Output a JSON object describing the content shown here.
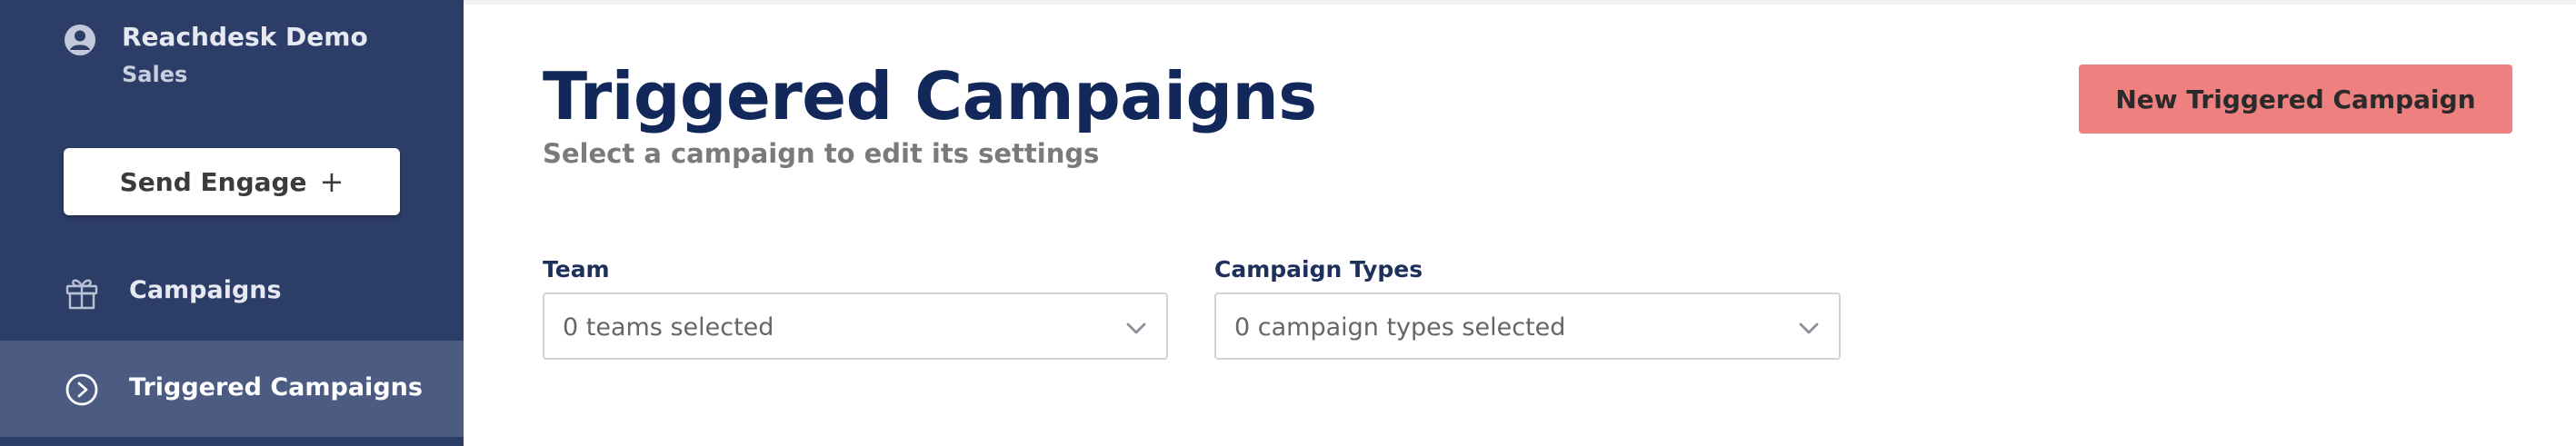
{
  "sidebar": {
    "account": {
      "name": "Reachdesk Demo",
      "role": "Sales",
      "icon": "user-circle-icon"
    },
    "send_button": {
      "label": "Send Engage",
      "icon": "plus"
    },
    "items": [
      {
        "label": "Campaigns",
        "icon": "gift-icon",
        "active": false
      },
      {
        "label": "Triggered Campaigns",
        "icon": "play-circle-icon",
        "active": true
      }
    ]
  },
  "main": {
    "title": "Triggered Campaigns",
    "subtitle": "Select a campaign to edit its settings",
    "new_button": "New Triggered Campaign",
    "filters": [
      {
        "label": "Team",
        "value": "0 teams selected"
      },
      {
        "label": "Campaign Types",
        "value": "0 campaign types selected"
      }
    ]
  },
  "colors": {
    "sidebar_bg": "#2c3e68",
    "sidebar_active_bg": "#4b5b82",
    "title": "#12285a",
    "primary_button": "#ef8080"
  }
}
